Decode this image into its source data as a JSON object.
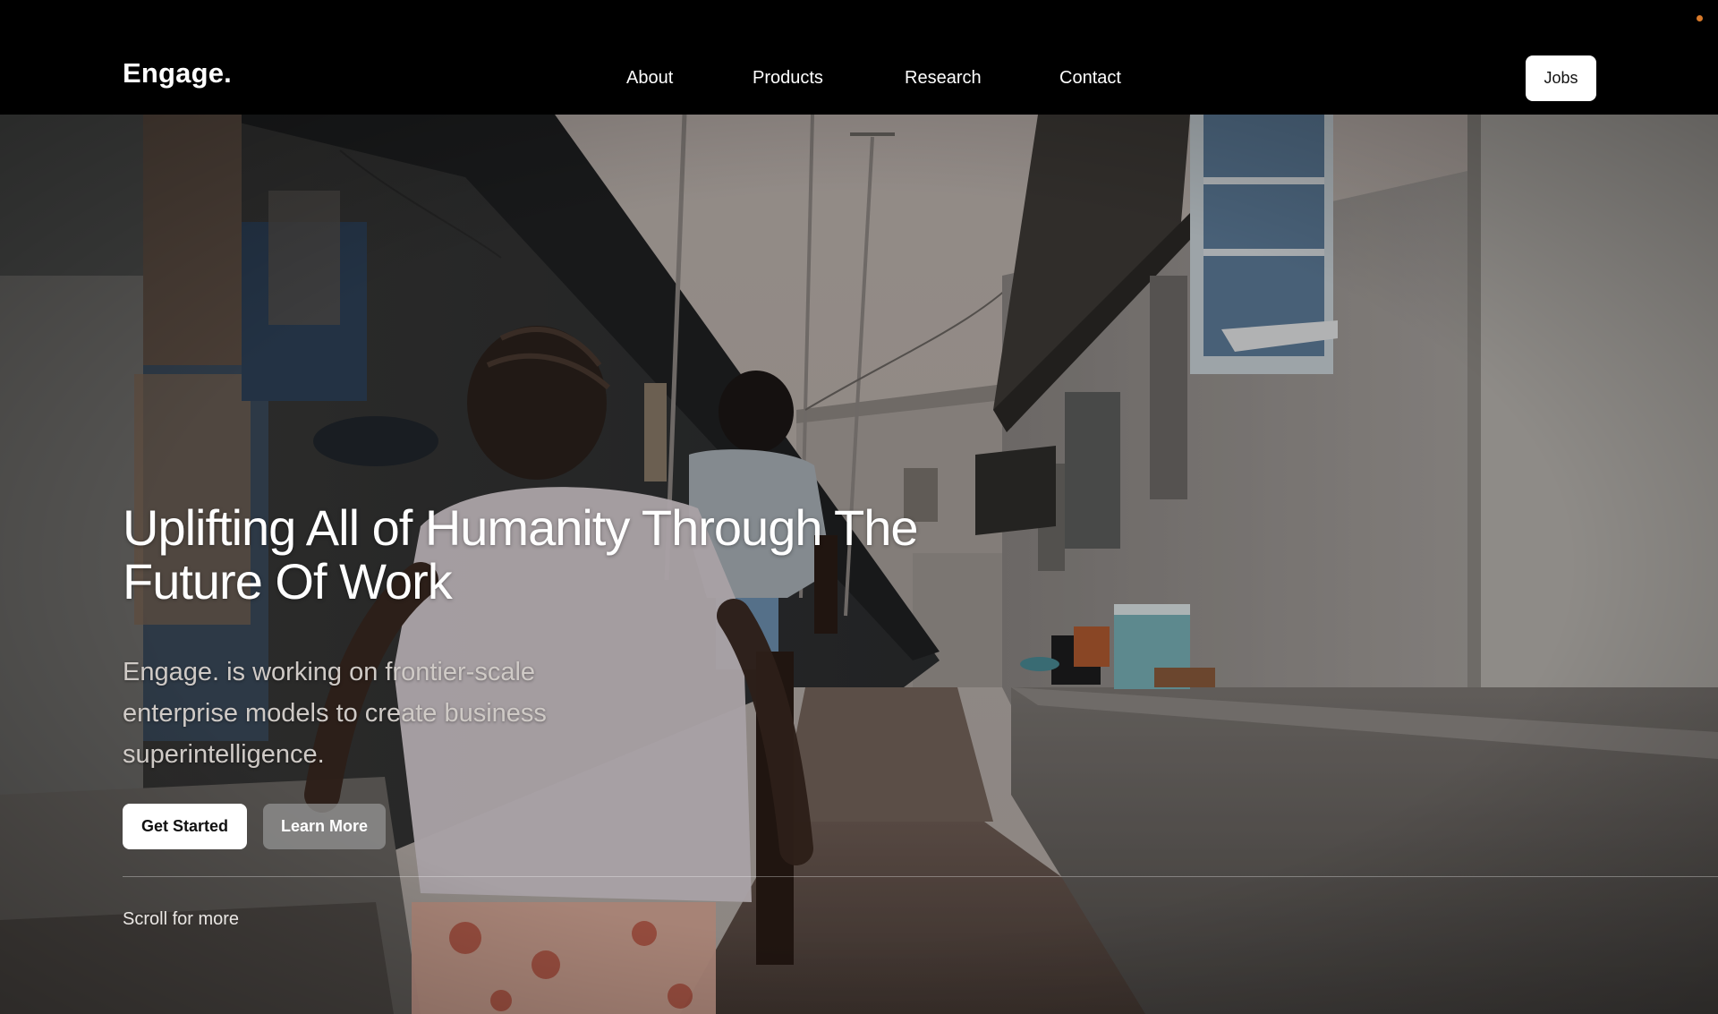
{
  "brand": {
    "logo_text": "Engage."
  },
  "nav": {
    "items": [
      {
        "label": "About"
      },
      {
        "label": "Products"
      },
      {
        "label": "Research"
      },
      {
        "label": "Contact"
      }
    ],
    "cta_label": "Jobs"
  },
  "hero": {
    "headline": "Uplifting All of Humanity Through The Future Of Work",
    "subtext": "Engage. is working on frontier-scale enterprise models to create business superintelligence.",
    "primary_button": "Get Started",
    "secondary_button": "Learn More",
    "scroll_hint": "Scroll for more",
    "background_image": "children-running-in-alley-photo"
  },
  "colors": {
    "nav_background": "#000000",
    "button_primary_bg": "#ffffff",
    "button_secondary_bg": "#969696",
    "status_dot": "#d97a2a"
  }
}
